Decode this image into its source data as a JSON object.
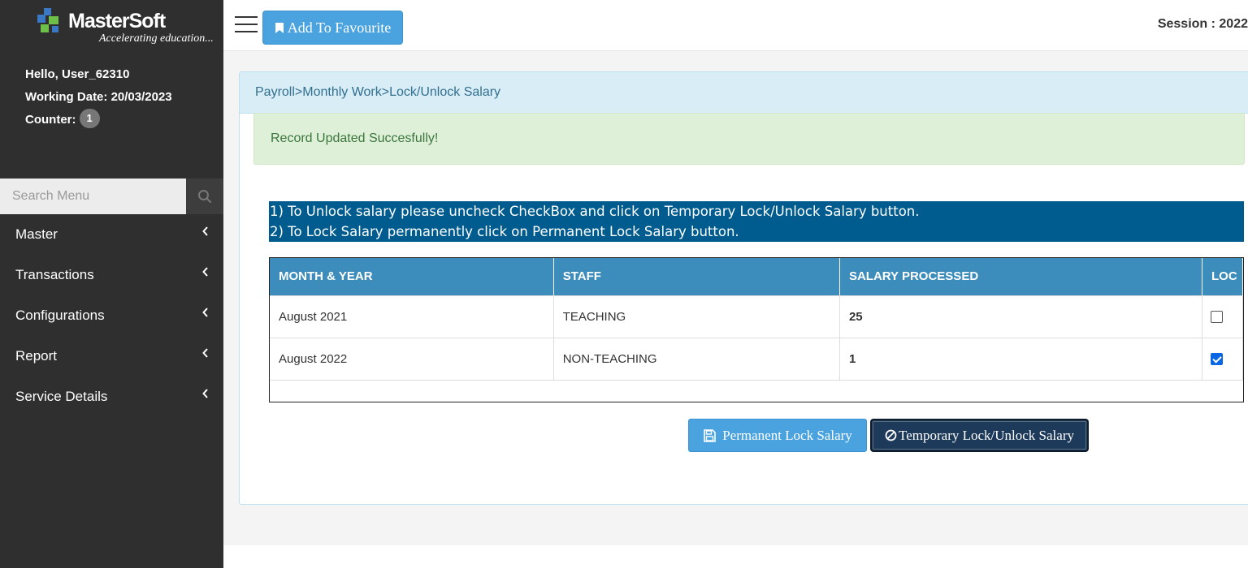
{
  "brand": {
    "name": "MasterSoft",
    "tagline": "Accelerating education..."
  },
  "user": {
    "greeting": "Hello, User_62310",
    "working_date": "Working Date: 20/03/2023",
    "counter_label": "Counter:",
    "counter_value": "1"
  },
  "search": {
    "placeholder": "Search Menu"
  },
  "sidebar": {
    "items": [
      {
        "label": "Master"
      },
      {
        "label": "Transactions"
      },
      {
        "label": "Configurations"
      },
      {
        "label": "Report"
      },
      {
        "label": "Service Details"
      }
    ]
  },
  "topbar": {
    "fav_label": "Add To Favourite",
    "session": "Session : 2022"
  },
  "breadcrumb": "Payroll>Monthly Work>Lock/Unlock Salary",
  "alert": "Record Updated Succesfully!",
  "notice": {
    "line1": "1) To Unlock salary please uncheck CheckBox and click on Temporary Lock/Unlock Salary button.",
    "line2": "2) To Lock Salary permanently click on Permanent Lock Salary button."
  },
  "table": {
    "headers": [
      "MONTH & YEAR",
      "STAFF",
      "SALARY PROCESSED",
      "LOC"
    ],
    "rows": [
      {
        "month": "August 2021",
        "staff": "TEACHING",
        "processed": "25",
        "locked": false
      },
      {
        "month": "August 2022",
        "staff": "NON-TEACHING",
        "processed": "1",
        "locked": true
      }
    ]
  },
  "buttons": {
    "permanent": "Permanent Lock Salary",
    "temporary": "Temporary Lock/Unlock Salary"
  },
  "colors": {
    "sidebar_bg": "#2f2f2f",
    "accent": "#4aa3df",
    "table_header": "#3c8dbc",
    "notice_bg": "#005b8f",
    "alert_bg": "#dff0d8"
  }
}
